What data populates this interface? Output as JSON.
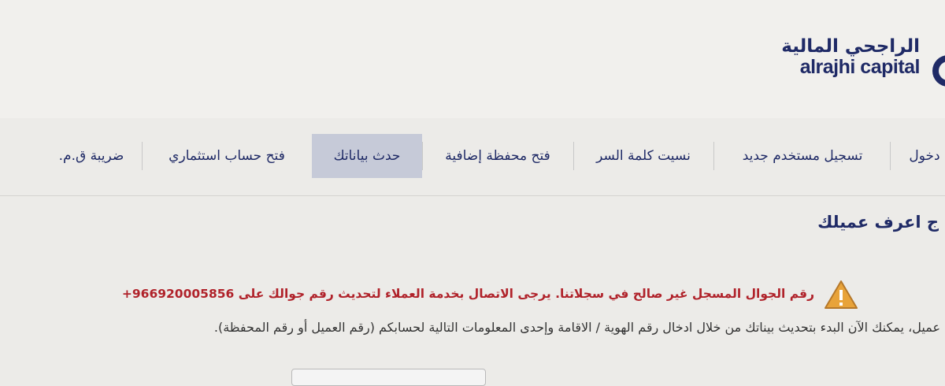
{
  "logo": {
    "arabic": "الراجحي المالية",
    "english": "alrajhi capital",
    "brand_color": "#1f2a66"
  },
  "nav": {
    "items": [
      {
        "label": "دخول"
      },
      {
        "label": "تسجيل مستخدم جديد"
      },
      {
        "label": "نسيت كلمة السر"
      },
      {
        "label": "فتح محفظة إضافية"
      },
      {
        "label": "حدث بياناتك",
        "active": true
      },
      {
        "label": "فتح حساب استثماري"
      },
      {
        "label": "ضريبة ق.م."
      }
    ]
  },
  "main": {
    "section_title": "ج اعرف عميلك",
    "warning_icon": "warning-triangle-icon",
    "error_message": "رقم الجوال المسجل غير صالح في سجلاتنا. يرجى الاتصال بخدمة العملاء لتحديث رقم جوالك على 966920005856+",
    "error_color": "#b0222a",
    "info_message": "عميل، يمكنك الآن البدء بتحديث بيناتك من خلال ادخال رقم الهوية / الاقامة وإحدى المعلومات التالية لحسابكم (رقم العميل أو رقم المحفظة)."
  }
}
